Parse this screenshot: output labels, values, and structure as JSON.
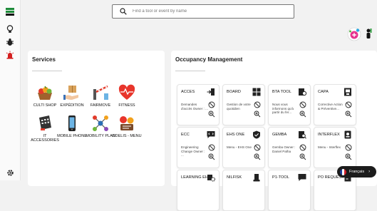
{
  "search": {
    "placeholder": "Find a tool or event by name"
  },
  "sidebar": {
    "icons": [
      "menu-icon",
      "lightbulb-icon",
      "bug-icon",
      "alarm-icon",
      "settings-icon"
    ]
  },
  "services": {
    "title": "Services",
    "items": [
      {
        "label": "CULTI SHOP",
        "icon": "fruit-basket-icon"
      },
      {
        "label": "EXPÉDITION",
        "icon": "package-hand-icon"
      },
      {
        "label": "FAIRMOVE",
        "icon": "barrier-gate-icon"
      },
      {
        "label": "FITNESS",
        "icon": "heart-pulse-icon"
      },
      {
        "label": "IT ACCESSORIES",
        "icon": "phone-keypad-icon"
      },
      {
        "label": "MOBILE PHONE",
        "icon": "mobile-phone-icon"
      },
      {
        "label": "MOBILITY PLAN",
        "icon": "mobility-network-icon"
      },
      {
        "label": "ODELIS - MENU",
        "icon": "menu-board-icon"
      }
    ]
  },
  "occupancy": {
    "title": "Occupancy Management",
    "tiles": [
      {
        "title": "ACCES",
        "desc": "Demandes d'accès Owner : ...",
        "icon": "door-enter-icon"
      },
      {
        "title": "BOARD",
        "desc": "Gestion de votre quotidien",
        "icon": "dashboard-grid-icon"
      },
      {
        "title": "BTA TOOL",
        "desc": "Nous vous informons qu'à partir du fer...",
        "icon": "badge-key-icon"
      },
      {
        "title": "CAPA",
        "desc": "Corrective Action & Préventive...",
        "icon": "document-stamp-icon"
      },
      {
        "title": "ECC",
        "desc": "Engineering Change Owner : ...",
        "icon": "chat-code-icon"
      },
      {
        "title": "EHS ONE",
        "desc": "Menu - EHS One",
        "icon": "shield-check-icon"
      },
      {
        "title": "GEMBA",
        "desc": "Gemba Owner : Daniel Palha",
        "icon": "clipboard-search-icon"
      },
      {
        "title": "INTERFLEX",
        "desc": "Menu - Interflex",
        "icon": "id-card-icon"
      },
      {
        "title": "LEARNING EHS",
        "desc": "",
        "icon": "learning-gear-icon"
      },
      {
        "title": "NILFISK",
        "desc": "",
        "icon": "floor-cleaner-icon"
      },
      {
        "title": "P1-TOOL",
        "desc": "",
        "icon": "tool-chat-icon"
      },
      {
        "title": "PO REQUEST",
        "desc": "",
        "icon": "po-document-icon"
      }
    ]
  },
  "language": {
    "label": "Français",
    "flag": "france-flag-icon"
  }
}
